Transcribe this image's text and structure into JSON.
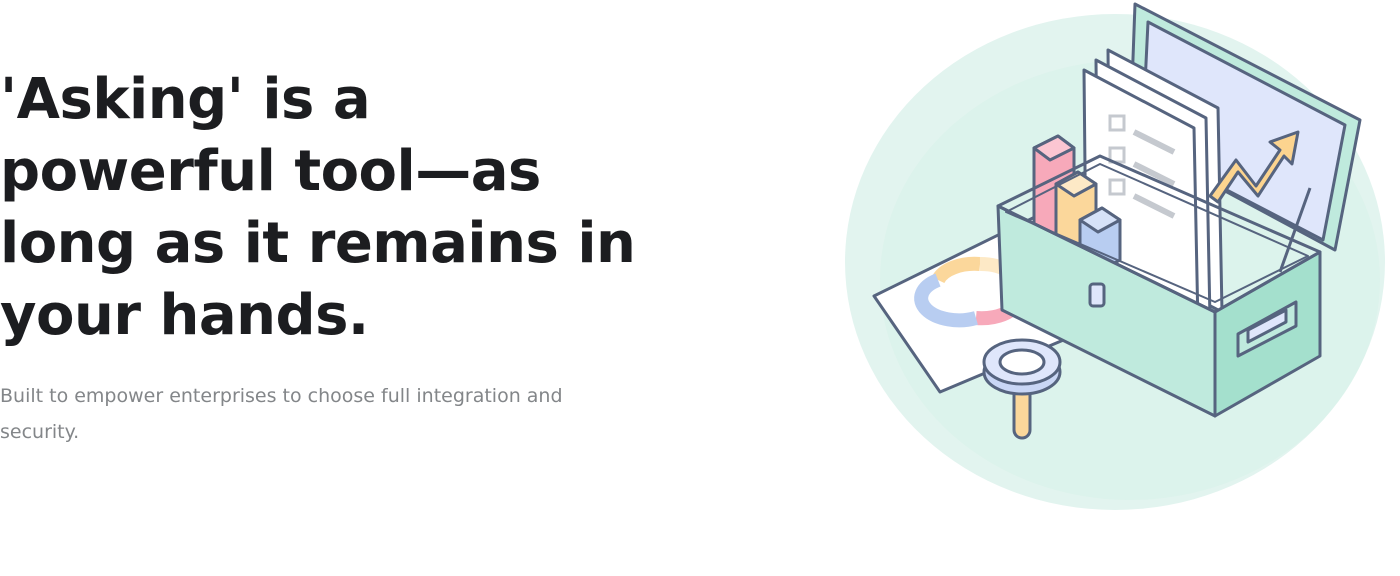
{
  "hero": {
    "headline": "'Asking' is a powerful tool—as long as it remains in your hands.",
    "subline": "Built to empower enterprises to choose full integration and security."
  },
  "illustration": {
    "icon": "toolbox-with-charts-and-documents",
    "colors": {
      "blob": "#e2f4ef",
      "outline": "#56647f",
      "box": "#bfeadd",
      "box_side": "#a4e0cd",
      "board": "#dfe6fb",
      "paper": "#ffffff",
      "bar_pink": "#f7a9ba",
      "bar_yellow": "#fbd79b",
      "bar_blue": "#b8cdf1",
      "arrow": "#fcd48f",
      "magnifier_ring": "#c9d6f5"
    }
  }
}
